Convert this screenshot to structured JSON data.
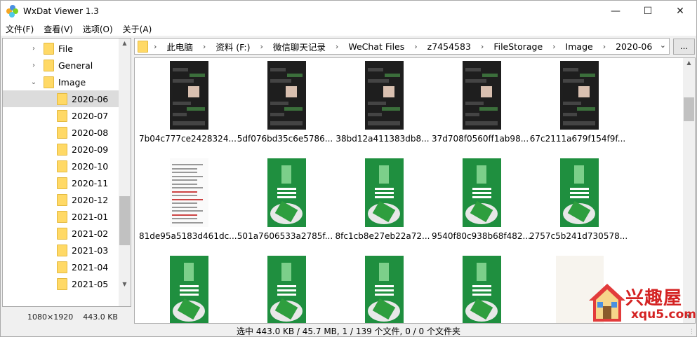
{
  "window": {
    "title": "WxDat Viewer 1.3"
  },
  "menu": [
    "文件(F)",
    "查看(V)",
    "选项(O)",
    "关于(A)"
  ],
  "tree": {
    "parents": [
      {
        "label": "File",
        "expanded": false
      },
      {
        "label": "General",
        "expanded": false
      },
      {
        "label": "Image",
        "expanded": true
      }
    ],
    "children": [
      "2020-06",
      "2020-07",
      "2020-08",
      "2020-09",
      "2020-10",
      "2020-11",
      "2020-12",
      "2021-01",
      "2021-02",
      "2021-03",
      "2021-04",
      "2021-05"
    ],
    "selected": "2020-06"
  },
  "tree_status": {
    "resolution": "1080×1920",
    "size": "443.0 KB"
  },
  "address": {
    "crumbs": [
      "此电脑",
      "资料 (F:)",
      "微信聊天记录",
      "WeChat Files",
      "z7454583",
      "FileStorage",
      "Image",
      "2020-06"
    ],
    "browse_label": "..."
  },
  "thumbnails": [
    {
      "label": "7b04c777ce2428324...",
      "kind": "phone"
    },
    {
      "label": "5df076bd35c6e5786...",
      "kind": "phone"
    },
    {
      "label": "38bd12a411383db8...",
      "kind": "phone"
    },
    {
      "label": "37d708f0560ff1ab98...",
      "kind": "phone"
    },
    {
      "label": "67c2111a679f154f9f...",
      "kind": "phone"
    },
    {
      "label": "81de95a5183d461dc...",
      "kind": "doc"
    },
    {
      "label": "501a7606533a2785f...",
      "kind": "zongzi"
    },
    {
      "label": "8fc1cb8e27eb22a72...",
      "kind": "zongzi"
    },
    {
      "label": "9540f80c938b68f482...",
      "kind": "zongzi"
    },
    {
      "label": "2757c5b241d730578...",
      "kind": "zongzi"
    },
    {
      "label": "",
      "kind": "zongzi"
    },
    {
      "label": "",
      "kind": "zongzi"
    },
    {
      "label": "",
      "kind": "zongzi"
    },
    {
      "label": "",
      "kind": "zongzi"
    },
    {
      "label": "",
      "kind": "festival"
    }
  ],
  "watermark": {
    "text": "兴趣屋",
    "url": "xqu5.com"
  },
  "status": {
    "text": "选中 443.0 KB / 45.7 MB, 1 / 139 个文件, 0 / 0 个文件夹"
  },
  "colors": {
    "folder": "#ffd966",
    "selection": "#dcdcdc",
    "watermark": "#d42222"
  },
  "icons": [
    "app-logo-icon",
    "minimize-icon",
    "maximize-icon",
    "close-icon",
    "folder-icon",
    "chevron-right-icon",
    "chevron-down-icon",
    "scroll-up-icon",
    "scroll-down-icon",
    "dropdown-arrow-icon"
  ]
}
